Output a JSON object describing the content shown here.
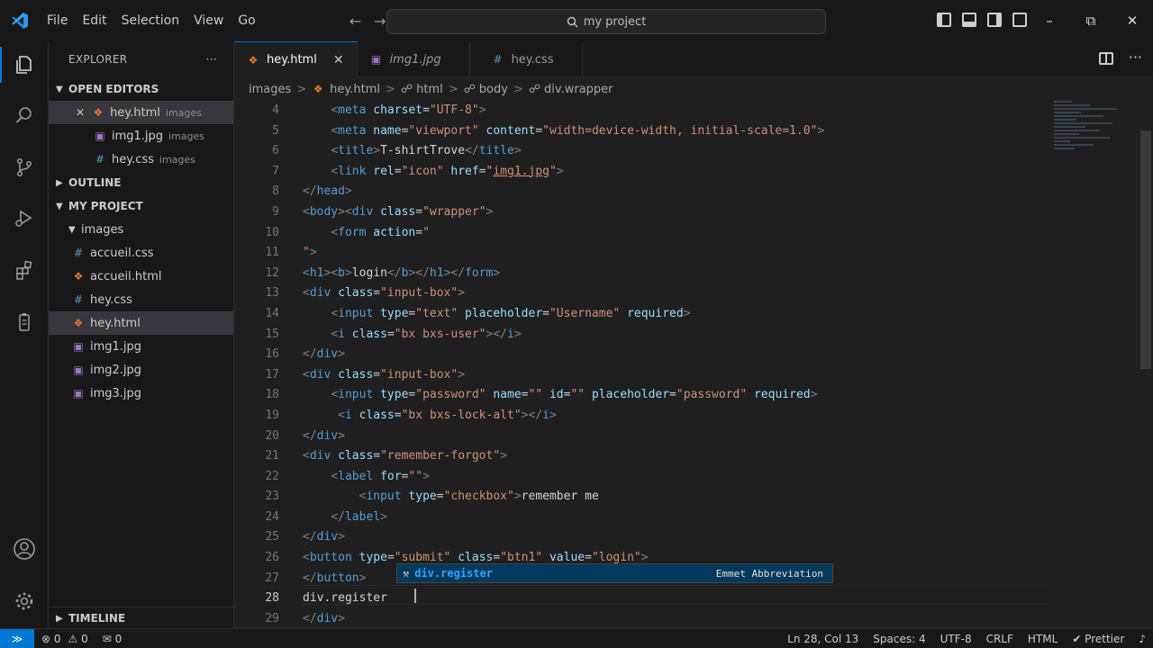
{
  "titlebar": {
    "menu": [
      "File",
      "Edit",
      "Selection",
      "View",
      "Go"
    ],
    "search_text": "my project",
    "back_arrow": "←",
    "forward_arrow": "→",
    "minimize": "–",
    "maximize": "⧉",
    "close": "✕"
  },
  "sidebar": {
    "title": "EXPLORER",
    "more": "···",
    "open_editors_label": "OPEN EDITORS",
    "open_editors": [
      {
        "name": "hey.html",
        "folder": "images",
        "type": "html",
        "close": "✕"
      },
      {
        "name": "img1.jpg",
        "folder": "images",
        "type": "img"
      },
      {
        "name": "hey.css",
        "folder": "images",
        "type": "css"
      }
    ],
    "outline_label": "OUTLINE",
    "project_label": "MY PROJECT",
    "folder": "images",
    "files": [
      {
        "name": "accueil.css",
        "type": "css"
      },
      {
        "name": "accueil.html",
        "type": "html"
      },
      {
        "name": "hey.css",
        "type": "css"
      },
      {
        "name": "hey.html",
        "type": "html"
      },
      {
        "name": "img1.jpg",
        "type": "img"
      },
      {
        "name": "img2.jpg",
        "type": "img"
      },
      {
        "name": "img3.jpg",
        "type": "img"
      }
    ],
    "timeline_label": "TIMELINE"
  },
  "tabs": [
    {
      "label": "hey.html",
      "type": "html",
      "close": "✕"
    },
    {
      "label": "img1.jpg",
      "type": "img"
    },
    {
      "label": "hey.css",
      "type": "css"
    }
  ],
  "more_actions": "···",
  "breadcrumb": {
    "items": [
      "images",
      "hey.html",
      "html",
      "body",
      "div.wrapper"
    ],
    "separator": ">"
  },
  "editor": {
    "line_numbers": [
      "4",
      "5",
      "6",
      "7",
      "8",
      "9",
      "10",
      "11",
      "12",
      "13",
      "14",
      "15",
      "16",
      "17",
      "18",
      "19",
      "20",
      "21",
      "22",
      "23",
      "24",
      "25",
      "26",
      "27",
      "28",
      "29"
    ],
    "current_line": "28"
  },
  "suggestion": {
    "prefix": "div.register",
    "type_label": "Emmet Abbreviation",
    "icon": "⚒"
  },
  "statusbar": {
    "remote": "≫",
    "errors": "⊗ 0",
    "warnings": "⚠ 0",
    "ports": "✉ 0",
    "position": "Ln 28, Col 13",
    "spaces": "Spaces: 4",
    "encoding": "UTF-8",
    "eol": "CRLF",
    "language": "HTML",
    "prettier": "✔ Prettier",
    "bell": "♪"
  }
}
